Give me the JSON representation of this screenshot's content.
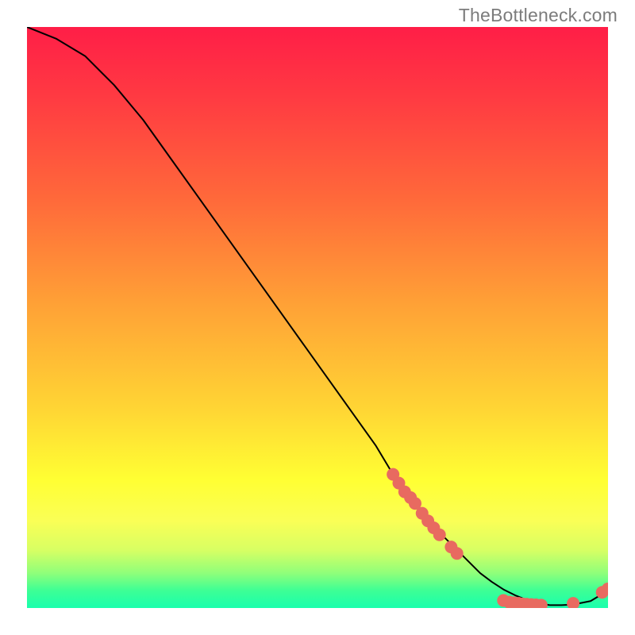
{
  "attribution": "TheBottleneck.com",
  "chart_data": {
    "type": "line",
    "title": "",
    "xlabel": "",
    "ylabel": "",
    "xlim": [
      0,
      100
    ],
    "ylim": [
      0,
      100
    ],
    "grid": false,
    "series": [
      {
        "name": "curve",
        "x": [
          0,
          5,
          10,
          15,
          20,
          25,
          30,
          35,
          40,
          45,
          50,
          55,
          60,
          63,
          66,
          70,
          73,
          76,
          78,
          80,
          82,
          84,
          86,
          88,
          90,
          92,
          94,
          97,
          100
        ],
        "y": [
          100,
          98,
          95,
          90,
          84,
          77,
          70,
          63,
          56,
          49,
          42,
          35,
          28,
          23,
          19,
          14,
          11,
          8,
          6,
          4.5,
          3.2,
          2.2,
          1.4,
          0.8,
          0.5,
          0.5,
          0.6,
          1.2,
          3.0
        ]
      }
    ],
    "markers": [
      {
        "name": "cluster-descent",
        "color": "#e86a60",
        "radius_px": 8,
        "points": [
          {
            "x": 63.0,
            "y": 23.0
          },
          {
            "x": 64.0,
            "y": 21.5
          },
          {
            "x": 65.0,
            "y": 20.0
          },
          {
            "x": 66.0,
            "y": 19.0
          },
          {
            "x": 66.8,
            "y": 18.0
          },
          {
            "x": 68.0,
            "y": 16.3
          },
          {
            "x": 69.0,
            "y": 15.0
          },
          {
            "x": 70.0,
            "y": 13.8
          },
          {
            "x": 71.0,
            "y": 12.6
          },
          {
            "x": 73.0,
            "y": 10.5
          },
          {
            "x": 74.0,
            "y": 9.4
          }
        ]
      },
      {
        "name": "cluster-valley",
        "color": "#e86a60",
        "radius_px": 8,
        "points": [
          {
            "x": 82.0,
            "y": 1.3
          },
          {
            "x": 83.0,
            "y": 1.0
          },
          {
            "x": 83.8,
            "y": 0.9
          },
          {
            "x": 84.6,
            "y": 0.8
          },
          {
            "x": 85.3,
            "y": 0.7
          },
          {
            "x": 86.0,
            "y": 0.65
          },
          {
            "x": 86.8,
            "y": 0.6
          },
          {
            "x": 87.6,
            "y": 0.55
          },
          {
            "x": 88.5,
            "y": 0.5
          }
        ]
      },
      {
        "name": "cluster-upturn",
        "color": "#e86a60",
        "radius_px": 8,
        "points": [
          {
            "x": 94.0,
            "y": 0.8
          },
          {
            "x": 99.0,
            "y": 2.7
          },
          {
            "x": 100.0,
            "y": 3.3
          }
        ]
      }
    ]
  }
}
